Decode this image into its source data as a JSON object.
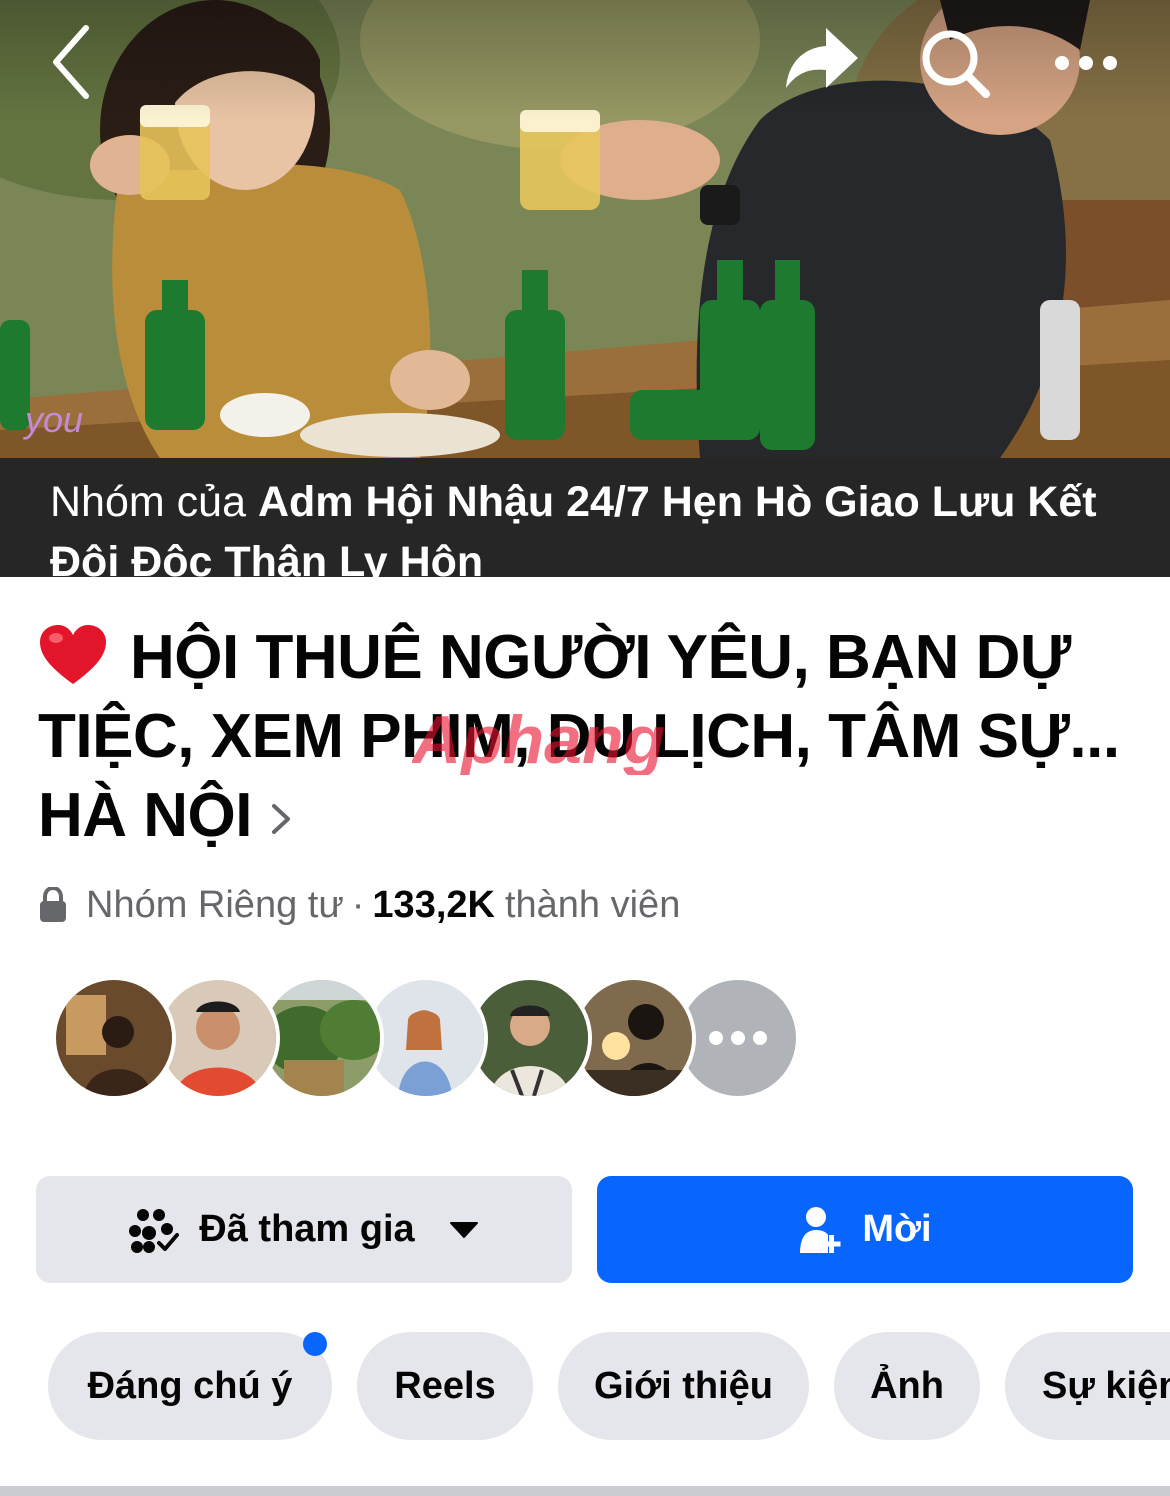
{
  "header": {
    "owner_prefix": "Nhóm của",
    "owner_name": "Adm Hội Nhậu 24/7 Hẹn Hò Giao Lưu Kết Đôi Độc Thân Ly Hôn",
    "icons": [
      "back-icon",
      "share-icon",
      "search-icon",
      "more-icon"
    ]
  },
  "group": {
    "title": "HỘI THUÊ NGƯỜI YÊU, BẠN DỰ TIỆC, XEM PHIM, DU LỊCH, TÂM SỰ... HÀ NỘI",
    "privacy": "Nhóm Riêng tư",
    "separator": "·",
    "member_count": "133,2K",
    "member_suffix": "thành viên"
  },
  "watermark": "Aphang",
  "actions": {
    "joined_label": "Đã tham gia",
    "invite_label": "Mời"
  },
  "tabs": [
    {
      "label": "Đáng chú ý",
      "notification_dot": true
    },
    {
      "label": "Reels"
    },
    {
      "label": "Giới thiệu"
    },
    {
      "label": "Ảnh"
    },
    {
      "label": "Sự kiện"
    }
  ],
  "colors": {
    "accent": "#0866ff",
    "button_gray": "#e4e6eb",
    "owner_bar": "#262626",
    "secondary_text": "#65676b"
  }
}
